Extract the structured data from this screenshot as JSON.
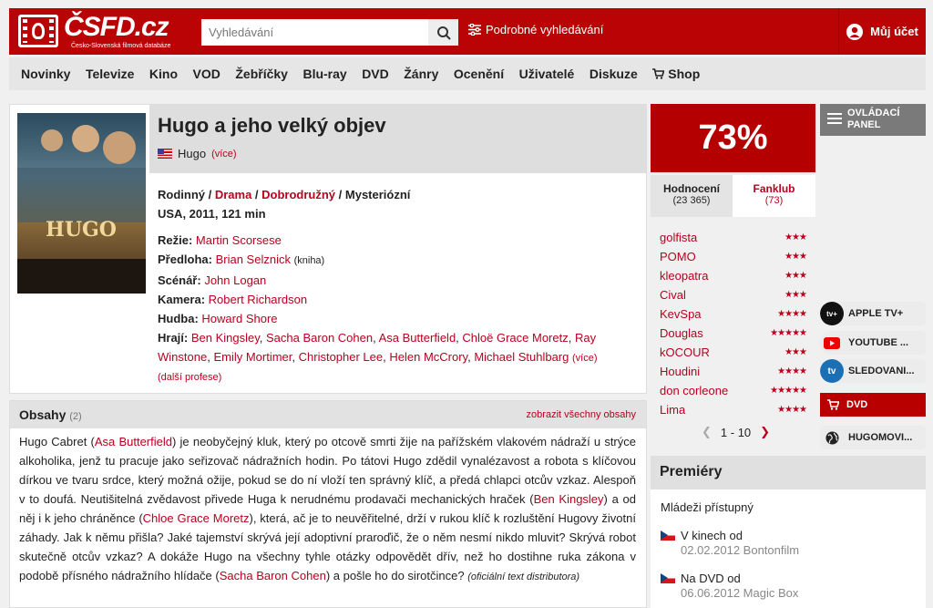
{
  "header": {
    "logo_text": "ČSFD.cz",
    "logo_sub": "Česko-Slovenská filmová databáze",
    "search_placeholder": "Vyhledávání",
    "advanced_search": "Podrobné vyhledávání",
    "account": "Můj účet"
  },
  "nav": [
    "Novinky",
    "Televize",
    "Kino",
    "VOD",
    "Žebříčky",
    "Blu-ray",
    "DVD",
    "Žánry",
    "Ocenění",
    "Uživatelé",
    "Diskuze",
    "Shop"
  ],
  "film": {
    "title": "Hugo a jeho velký objev",
    "original_title": "Hugo",
    "more": "(více)",
    "genres": [
      "Rodinný",
      "Drama",
      "Dobrodružný",
      "Mysteriózní"
    ],
    "origin_line": "USA, 2011, 121 min",
    "director_label": "Režie:",
    "director": "Martin Scorsese",
    "source_label": "Předloha:",
    "source": "Brian Selznick",
    "source_note": "(kniha)",
    "writer_label": "Scénář:",
    "writer": "John Logan",
    "camera_label": "Kamera:",
    "camera": "Robert Richardson",
    "music_label": "Hudba:",
    "music": "Howard Shore",
    "cast_label": "Hrají:",
    "cast": [
      "Ben Kingsley",
      "Sacha Baron Cohen",
      "Asa Butterfield",
      "Chloë Grace Moretz",
      "Ray Winstone",
      "Emily Mortimer",
      "Christopher Lee",
      "Helen McCrory",
      "Michael Stuhlbarg"
    ],
    "cast_more": "(více)",
    "other_roles": "(další profese)"
  },
  "plot": {
    "title": "Obsahy",
    "count": "(2)",
    "show_all": "zobrazit všechny obsahy",
    "t1": "Hugo Cabret (",
    "l1": "Asa Butterfield",
    "t2": ") je neobyčejný kluk, který po otcově smrti žije na pařížském vlakovém nádraží u strýce alkoholika, jenž tu pracuje jako seřizovač nádražních hodin. Po tátovi Hugo zdědil vynalézavost a robota s klíčovou dírkou ve tvaru srdce, který možná ožije, pokud se do ní vloží ten správný klíč, a předá chlapci otcův vzkaz. Alespoň v to doufá. Neutišitelná zvědavost přivede Huga k nerudnému prodavači mechanických hraček (",
    "l2": "Ben Kingsley",
    "t3": ") a od něj i k jeho chráněnce (",
    "l3": "Chloe Grace Moretz",
    "t4": "), která, ač je to neuvěřitelné, drží v rukou klíč k rozluštění Hugovy životní záhady. Jak k němu přišla? Jaké tajemství skrývá její adoptivní praroďič, že o něm nesmí nikdo mluvit? Skrývá robot skutečně otcův vzkaz? A dokáže Hugo na všechny tyhle otázky odpovědět dřív, než ho dostihne ruka zákona v podobě přísného nádražního hlídače (",
    "l4": "Sacha Baron Cohen",
    "t5": ") a pošle ho do sirotčince?",
    "source": "(oficiální text distributora)"
  },
  "rating": {
    "percent": "73%",
    "tab_rating": "Hodnocení",
    "tab_rating_count": "(23 365)",
    "tab_fan": "Fanklub",
    "tab_fan_count": "(73)",
    "raters": [
      {
        "name": "golfista",
        "stars": 3
      },
      {
        "name": "POMO",
        "stars": 3
      },
      {
        "name": "kleopatra",
        "stars": 3
      },
      {
        "name": "Cival",
        "stars": 3
      },
      {
        "name": "KevSpa",
        "stars": 4
      },
      {
        "name": "Douglas",
        "stars": 5
      },
      {
        "name": "kOCOUR",
        "stars": 3
      },
      {
        "name": "Houdini",
        "stars": 4
      },
      {
        "name": "don corleone",
        "stars": 5
      },
      {
        "name": "Lima",
        "stars": 4
      }
    ],
    "pager": "1 - 10"
  },
  "side": {
    "control_panel": "OVLÁDACÍ PANEL",
    "vod": [
      "APPLE TV+",
      "YOUTUBE ...",
      "SLEDOVANI..."
    ],
    "dvd": "DVD",
    "hugomovie": "HUGOMOVI..."
  },
  "premieres": {
    "title": "Premiéry",
    "rating": "Mládeži přístupný",
    "items": [
      {
        "label": "V kinech od",
        "date": "02.02.2012 Bontonfilm"
      },
      {
        "label": "Na DVD od",
        "date": "06.06.2012 Magic Box"
      }
    ]
  },
  "colors": {
    "brand": "#ba0305",
    "link": "#b9001e"
  }
}
